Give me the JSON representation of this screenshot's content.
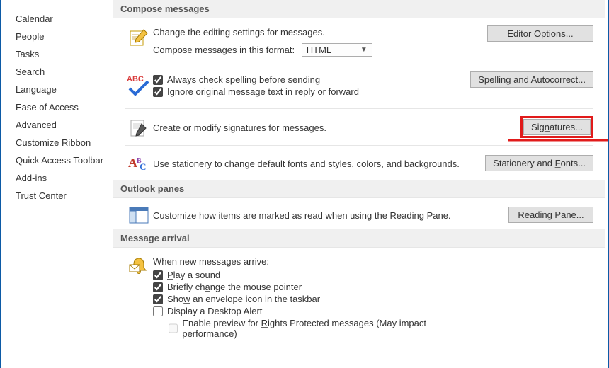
{
  "sidebar": {
    "items": [
      {
        "label": "Calendar"
      },
      {
        "label": "People"
      },
      {
        "label": "Tasks"
      },
      {
        "label": "Search"
      },
      {
        "label": "Language"
      },
      {
        "label": "Ease of Access"
      },
      {
        "label": "Advanced"
      },
      {
        "label": "Customize Ribbon"
      },
      {
        "label": "Quick Access Toolbar"
      },
      {
        "label": "Add-ins"
      },
      {
        "label": "Trust Center"
      }
    ]
  },
  "sections": {
    "compose_header": "Compose messages",
    "compose_desc": "Change the editing settings for messages.",
    "compose_format_label_pre": "C",
    "compose_format_label_post": "ompose messages in this format:",
    "compose_format_value": "HTML",
    "editor_btn": "Editor Options...",
    "spell_check_pre": "A",
    "spell_check_post": "lways check spelling before sending",
    "spell_ignore_pre": "I",
    "spell_ignore_post": "gnore original message text in reply or forward",
    "spell_btn_pre": "S",
    "spell_btn_post": "pelling and Autocorrect...",
    "sign_desc": "Create or modify signatures for messages.",
    "sign_btn_pre": "Sig",
    "sign_btn_u": "n",
    "sign_btn_post": "atures...",
    "stationery_desc": "Use stationery to change default fonts and styles, colors, and backgrounds.",
    "stationery_btn_pre": "Stationery and ",
    "stationery_btn_u": "F",
    "stationery_btn_post": "onts...",
    "panes_header": "Outlook panes",
    "panes_desc": "Customize how items are marked as read when using the Reading Pane.",
    "panes_btn_pre": "R",
    "panes_btn_post": "eading Pane...",
    "arrival_header": "Message arrival",
    "arrival_intro": "When new messages arrive:",
    "arrival_sound_pre": "P",
    "arrival_sound_post": "lay a sound",
    "arrival_cursor_pre": "Briefly ch",
    "arrival_cursor_u": "a",
    "arrival_cursor_post": "nge the mouse pointer",
    "arrival_envelope_pre": "Sho",
    "arrival_envelope_u": "w",
    "arrival_envelope_post": " an envelope icon in the taskbar",
    "arrival_desktop": "Display a Desktop Alert",
    "arrival_rights_pre": "Enable preview for ",
    "arrival_rights_u": "R",
    "arrival_rights_post": "ights Protected messages (May impact performance)"
  }
}
